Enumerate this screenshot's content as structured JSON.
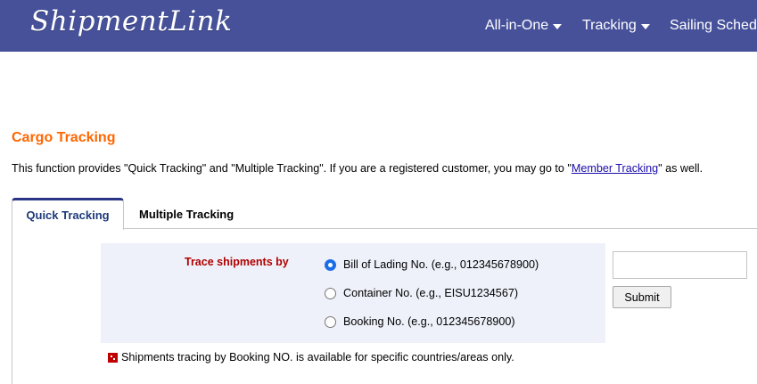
{
  "header": {
    "logo_text": "ShipmentLink",
    "nav": [
      {
        "label": "All-in-One",
        "has_dropdown": true
      },
      {
        "label": "Tracking",
        "has_dropdown": true
      },
      {
        "label": "Sailing Sched",
        "has_dropdown": false
      }
    ]
  },
  "page": {
    "title": "Cargo Tracking",
    "intro_before": "This function provides \"Quick Tracking\" and \"Multiple Tracking\". If you are a registered customer, you may go to \"",
    "intro_link": "Member Tracking",
    "intro_after": "\" as well."
  },
  "tabs": [
    {
      "label": "Quick Tracking",
      "active": true
    },
    {
      "label": "Multiple Tracking",
      "active": false
    }
  ],
  "trace": {
    "label": "Trace shipments by",
    "options": [
      {
        "label": "Bill of Lading No. (e.g., 012345678900)",
        "checked": true
      },
      {
        "label": "Container No. (e.g., EISU1234567)",
        "checked": false
      },
      {
        "label": "Booking No. (e.g., 012345678900)",
        "checked": false
      }
    ],
    "input_value": "",
    "submit_label": "Submit"
  },
  "note": {
    "text": "Shipments tracing by Booking NO. is available for specific countries/areas only.",
    "icon": "red-square-icon"
  },
  "colors": {
    "header_bg": "#46519a",
    "title_orange": "#ff6600",
    "trace_label_red": "#b00000",
    "panel_bg": "#eef1f9",
    "tab_active_border": "#2a3585"
  }
}
